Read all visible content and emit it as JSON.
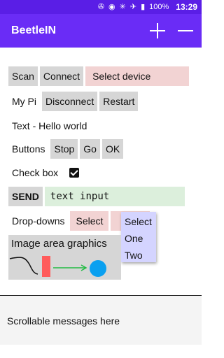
{
  "status_bar": {
    "icons": [
      "usb-icon",
      "android-debug-icon",
      "bluetooth-icon",
      "airplane-icon",
      "battery-icon"
    ],
    "battery": "100%",
    "time": "13:29"
  },
  "app_bar": {
    "title": "BeetleIN",
    "color": "#6a2cf6"
  },
  "rows": {
    "scan": "Scan",
    "connect": "Connect",
    "select_device": "Select device",
    "my_pi": "My Pi",
    "disconnect": "Disconnect",
    "restart": "Restart",
    "text_label": "Text - Hello world",
    "buttons_label": "Buttons",
    "stop": "Stop",
    "go": "Go",
    "ok": "OK",
    "checkbox_label": "Check box",
    "send": "SEND",
    "text_input": "text input",
    "dropdowns_label": "Drop-downs",
    "select": "Select"
  },
  "dropdown": {
    "options": [
      "Select",
      "One",
      "Two"
    ]
  },
  "image_area": {
    "caption": "Image area graphics"
  },
  "messages": {
    "text": "Scrollable messages here"
  }
}
